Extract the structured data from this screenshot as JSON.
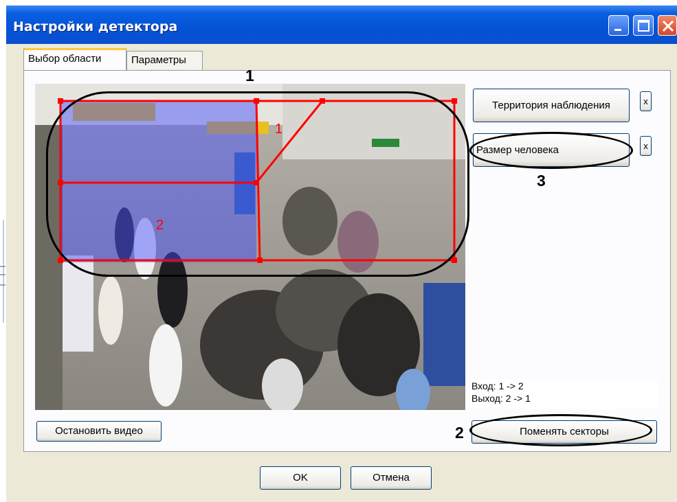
{
  "window": {
    "title": "Настройки детектора"
  },
  "titlebar_buttons": {
    "minimize": "minimize-icon",
    "maximize": "maximize-icon",
    "close": "close-icon"
  },
  "tabs": [
    {
      "label": "Выбор области",
      "active": true
    },
    {
      "label": "Параметры",
      "active": false
    }
  ],
  "video": {
    "sector_labels": [
      "1",
      "2"
    ],
    "stop_label": "Остановить видео"
  },
  "right": {
    "area_button": "Территория наблюдения",
    "person_button": "Размер человека",
    "remove_label": "x",
    "info_lines": [
      "Вход: 1 -> 2",
      "Выход: 2 -> 1"
    ],
    "swap_button": "Поменять секторы"
  },
  "annotations": {
    "a1": "1",
    "a2": "2",
    "a3": "3"
  },
  "footer": {
    "ok": "OK",
    "cancel": "Отмена"
  },
  "colors": {
    "title_bar": "#0453d6",
    "face": "#ece9d8",
    "zone": "#ff0000",
    "zone_overlay": "#3c46ff"
  }
}
